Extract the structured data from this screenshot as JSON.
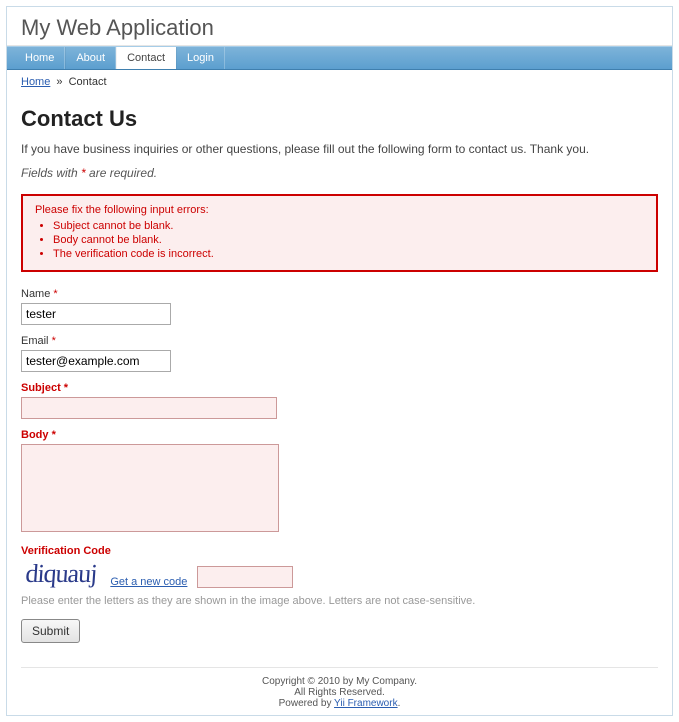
{
  "header": {
    "title": "My Web Application"
  },
  "mainmenu": {
    "items": [
      {
        "label": "Home"
      },
      {
        "label": "About"
      },
      {
        "label": "Contact",
        "active": true
      },
      {
        "label": "Login"
      }
    ]
  },
  "breadcrumbs": {
    "home": "Home",
    "sep": "»",
    "current": "Contact"
  },
  "page": {
    "heading": "Contact Us",
    "intro": "If you have business inquiries or other questions, please fill out the following form to contact us. Thank you.",
    "required_note_prefix": "Fields with ",
    "required_star": "*",
    "required_note_suffix": " are required."
  },
  "errors": {
    "heading": "Please fix the following input errors:",
    "items": [
      "Subject cannot be blank.",
      "Body cannot be blank.",
      "The verification code is incorrect."
    ]
  },
  "form": {
    "name": {
      "label": "Name",
      "value": "tester",
      "required": true,
      "error": false
    },
    "email": {
      "label": "Email",
      "value": "tester@example.com",
      "required": true,
      "error": false
    },
    "subject": {
      "label": "Subject",
      "value": "",
      "required": true,
      "error": true
    },
    "body": {
      "label": "Body",
      "value": "",
      "required": true,
      "error": true
    },
    "verify": {
      "label": "Verification Code",
      "captcha_text": "diquauj",
      "new_code": "Get a new code",
      "value": "",
      "error": true,
      "hint": "Please enter the letters as they are shown in the image above. Letters are not case-sensitive."
    },
    "submit": "Submit"
  },
  "footer": {
    "line1": "Copyright © 2010 by My Company.",
    "line2": "All Rights Reserved.",
    "line3_prefix": "Powered by ",
    "line3_link": "Yii Framework",
    "line3_suffix": "."
  }
}
